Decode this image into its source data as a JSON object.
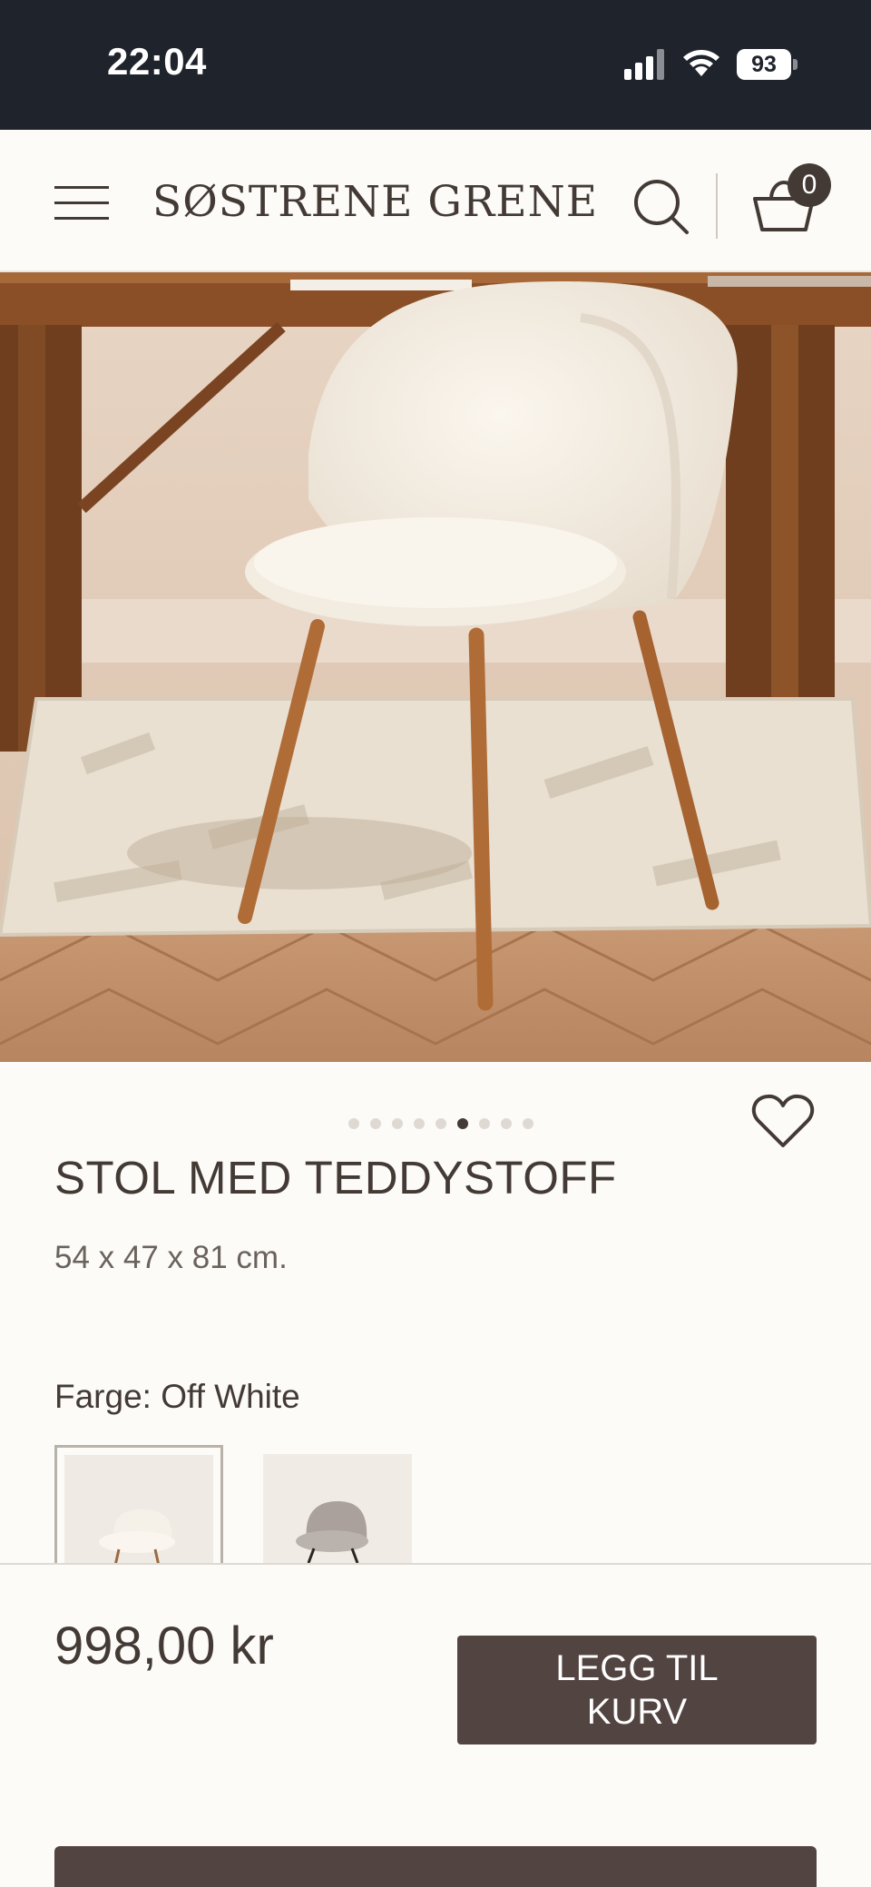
{
  "status_bar": {
    "time": "22:04",
    "battery": "93",
    "icons": [
      "signal-icon",
      "wifi-icon",
      "battery-icon"
    ]
  },
  "header": {
    "brand": "SØSTRENE GRENE",
    "cart_count": "0",
    "icons": [
      "menu-icon",
      "search-icon",
      "cart-icon"
    ]
  },
  "product": {
    "title": "STOL MED TEDDYSTOFF",
    "dimensions": "54 x 47 x 81 cm.",
    "color_label": "Farge: Off White",
    "carousel": {
      "total": 9,
      "active": 6
    },
    "swatches": [
      "Off White",
      "Grey"
    ]
  },
  "purchase": {
    "price": "998,00 kr",
    "add_to_cart_label": "LEGG TIL KURV"
  },
  "colors": {
    "status_bg": "#1f232c",
    "page_bg": "#fcfbf7",
    "text": "#433a35",
    "button": "#524440"
  }
}
